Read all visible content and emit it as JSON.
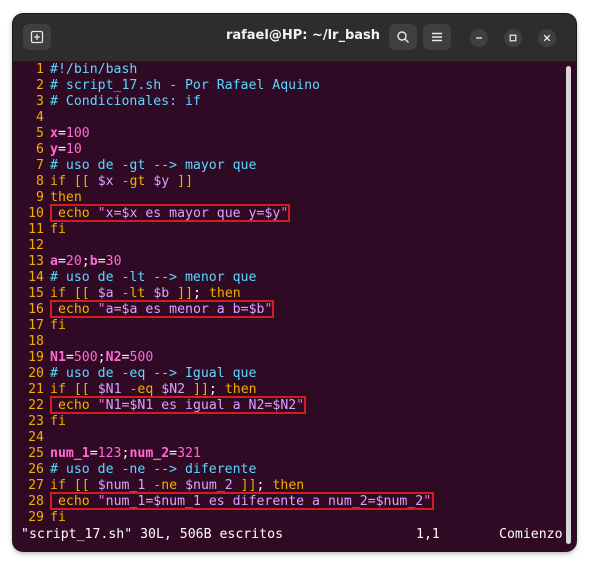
{
  "window": {
    "title": "rafael@HP: ~/lr_bash",
    "buttons": {
      "new_tab_icon": "new-tab",
      "search_icon": "search",
      "menu_icon": "menu"
    },
    "controls": [
      "minimize",
      "maximize",
      "close"
    ]
  },
  "code": [
    {
      "n": "1",
      "t": "#!/bin/bash",
      "k": "comment"
    },
    {
      "n": "2",
      "t": "# script_17.sh - Por Rafael Aquino",
      "k": "comment"
    },
    {
      "n": "3",
      "t": "# Condicionales: if",
      "k": "comment"
    },
    {
      "n": "4",
      "t": "",
      "k": "plain"
    },
    {
      "n": "5",
      "t": "x=100",
      "k": "assign"
    },
    {
      "n": "6",
      "t": "y=10",
      "k": "assign"
    },
    {
      "n": "7",
      "t": "# uso de -gt --> mayor que",
      "k": "comment"
    },
    {
      "n": "8",
      "t": "if [[ $x -gt $y ]]",
      "k": "plain"
    },
    {
      "n": "9",
      "t": "then",
      "k": "plain"
    },
    {
      "n": "10",
      "t": " echo \"x=$x es mayor que y=$y\"",
      "k": "plain",
      "box": true
    },
    {
      "n": "11",
      "t": "fi",
      "k": "plain"
    },
    {
      "n": "12",
      "t": "",
      "k": "plain"
    },
    {
      "n": "13",
      "t": "a=20;b=30",
      "k": "assign"
    },
    {
      "n": "14",
      "t": "# uso de -lt --> menor que",
      "k": "comment"
    },
    {
      "n": "15",
      "t": "if [[ $a -lt $b ]]; then",
      "k": "plain"
    },
    {
      "n": "16",
      "t": " echo \"a=$a es menor a b=$b\"",
      "k": "plain",
      "box": true
    },
    {
      "n": "17",
      "t": "fi",
      "k": "plain"
    },
    {
      "n": "18",
      "t": "",
      "k": "plain"
    },
    {
      "n": "19",
      "t": "N1=500;N2=500",
      "k": "assign"
    },
    {
      "n": "20",
      "t": "# uso de -eq --> Igual que",
      "k": "comment"
    },
    {
      "n": "21",
      "t": "if [[ $N1 -eq $N2 ]]; then",
      "k": "plain"
    },
    {
      "n": "22",
      "t": " echo \"N1=$N1 es igual a N2=$N2\"",
      "k": "plain",
      "box": true
    },
    {
      "n": "23",
      "t": "fi",
      "k": "plain"
    },
    {
      "n": "24",
      "t": "",
      "k": "plain"
    },
    {
      "n": "25",
      "t": "num_1=123;num_2=321",
      "k": "assign"
    },
    {
      "n": "26",
      "t": "# uso de -ne --> diferente",
      "k": "comment"
    },
    {
      "n": "27",
      "t": "if [[ $num_1 -ne $num_2 ]]; then",
      "k": "plain"
    },
    {
      "n": "28",
      "t": " echo \"num_1=$num_1 es diferente a num_2=$num_2\"",
      "k": "plain",
      "box": true
    },
    {
      "n": "29",
      "t": "fi",
      "k": "plain"
    }
  ],
  "status": {
    "file": "\"script_17.sh\" 30L, 506B escritos",
    "position": "1,1",
    "scroll": "Comienzo"
  },
  "colors": {
    "background": "#300a24",
    "line_numbers": "#f0b000",
    "comments": "#5fd7ff",
    "highlight_box": "#cc1f1f"
  }
}
